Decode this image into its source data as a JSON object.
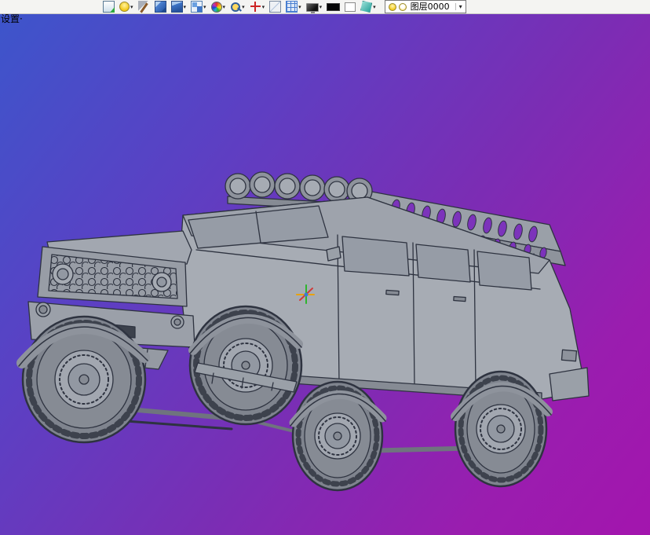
{
  "toolbar": {
    "icons": [
      "paste-special",
      "render-lightbulb",
      "material-tool",
      "solid-cube",
      "solid-box",
      "assembly-boxes",
      "color-wheel",
      "zoom-magnifier",
      "target-point",
      "sketch-plane",
      "grid-snap",
      "display-monitor",
      "black-color-swatch",
      "white-color-swatch",
      "surface-shade"
    ],
    "layer_control": {
      "label": "图层0000"
    }
  },
  "viewport": {
    "settings_label": "设置·",
    "gradient": {
      "top_left": "#3d55cb",
      "middle": "#7b2db4",
      "bottom_right": "#a315ae"
    },
    "model": {
      "name": "off-road-suv-3d-model",
      "body_color": "#a7acb4",
      "edge_color": "#2e3340"
    }
  }
}
